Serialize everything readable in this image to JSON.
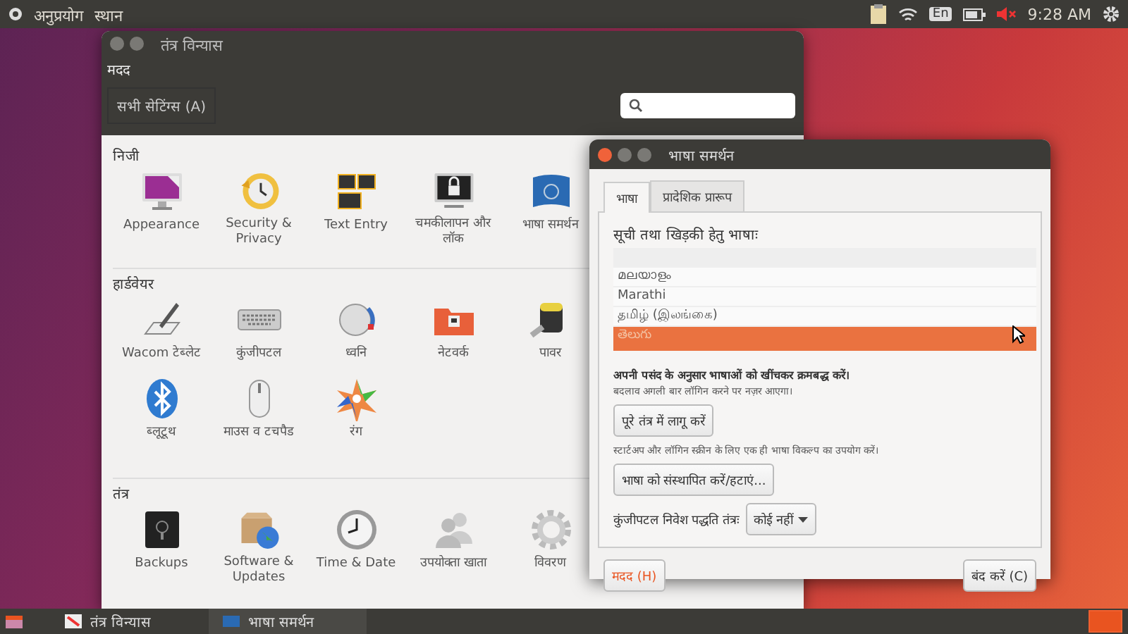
{
  "top_panel": {
    "menus": [
      "अनुप्रयोग",
      "स्थान"
    ],
    "keyboard_layout": "En",
    "volume_muted": true,
    "clock": "9:28 AM"
  },
  "settings_window": {
    "title": "तंत्र विन्यास",
    "menu": [
      "मदद"
    ],
    "all_settings_button": "सभी सेटिंग्स (A)",
    "sections": [
      {
        "title": "निजी",
        "items": [
          "Appearance",
          "Security & Privacy",
          "Text Entry",
          "चमकीलापन और लॉक",
          "भाषा समर्थन"
        ]
      },
      {
        "title": "हार्डवेयर",
        "items": [
          "Wacom टेब्लेट",
          "कुंजीपटल",
          "ध्वनि",
          "नेटवर्क",
          "पावर",
          "ब्लूटूथ",
          "माउस व टचपैड",
          "रंग"
        ]
      },
      {
        "title": "तंत्र",
        "items": [
          "Backups",
          "Software & Updates",
          "Time & Date",
          "उपयोक्ता खाता",
          "विवरण"
        ]
      }
    ]
  },
  "dialog": {
    "title": "भाषा समर्थन",
    "tabs": [
      {
        "label": "भाषा",
        "selected": true
      },
      {
        "label": "प्रादेशिक प्रारूप",
        "selected": false
      }
    ],
    "list_label": "सूची तथा खिड़की हेतु भाषाः",
    "languages": [
      {
        "name": "മലയാളം",
        "selected": false
      },
      {
        "name": "Marathi",
        "selected": false
      },
      {
        "name": "தமிழ் (இலங்கை)",
        "selected": false
      },
      {
        "name": "తెలుగు",
        "selected": true
      }
    ],
    "hint": "अपनी पसंद के अनुसार भाषाओं को खींचकर क्रमबद्ध करें।",
    "note": "बदलाव अगली बार लॉगिन करने पर नज़र आएगा।",
    "apply_button": "पूरे तंत्र में लागू करें",
    "apply_note": "स्टार्टअप और लॉगिन स्क्रीन के लिए एक ही भाषा विकल्प का उपयोग करें।",
    "install_button": "भाषा को संस्थापित करें/हटाएं...",
    "input_method_label": "कुंजीपटल निवेश पद्धति तंत्रः",
    "input_method_value": "कोई नहीं",
    "help_button": "मदद (H)",
    "close_button": "बंद करें (C)"
  },
  "taskbar": {
    "items": [
      {
        "label": "तंत्र विन्यास",
        "selected": false
      },
      {
        "label": "भाषा समर्थन",
        "selected": true
      }
    ]
  }
}
